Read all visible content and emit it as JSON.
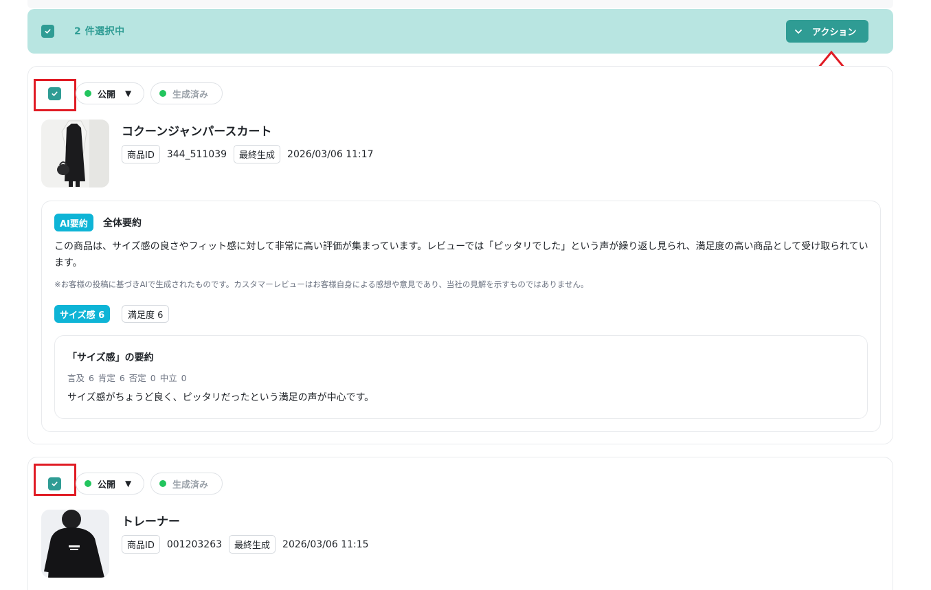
{
  "selection": {
    "count_label": "2 件選択中",
    "action_label": "アクション"
  },
  "colors": {
    "accent": "#2f9c94",
    "selection_bg": "#b8e5e1",
    "status_green": "#22c55e",
    "ai_badge": "#0eb4d6",
    "annotation_red": "#e01b24"
  },
  "products": [
    {
      "status_label": "公開",
      "status_caret": "▼",
      "generated_label": "生成済み",
      "name": "コクーンジャンパースカート",
      "id_tag": "商品ID",
      "id_value": "344_511039",
      "last_gen_tag": "最終生成",
      "last_gen_value": "2026/03/06 11:17",
      "ai_summary": {
        "badge": "AI要約",
        "title": "全体要約",
        "body": "この商品は、サイズ感の良さやフィット感に対して非常に高い評価が集まっています。レビューでは「ピッタリでした」という声が繰り返し見られ、満足度の高い商品として受け取られています。",
        "note": "※お客様の投稿に基づきAIで生成されたものです。カスタマーレビューはお客様自身による感想や意見であり、当社の見解を示すものではありません。",
        "chips": [
          "サイズ感 6",
          "満足度 6"
        ],
        "detail": {
          "title": "「サイズ感」の要約",
          "stats": "言及 6   肯定 6   否定 0   中立 0",
          "text": "サイズ感がちょうど良く、ピッタリだったという満足の声が中心です。"
        }
      }
    },
    {
      "status_label": "公開",
      "status_caret": "▼",
      "generated_label": "生成済み",
      "name": "トレーナー",
      "id_tag": "商品ID",
      "id_value": "001203263",
      "last_gen_tag": "最終生成",
      "last_gen_value": "2026/03/06 11:15"
    }
  ]
}
